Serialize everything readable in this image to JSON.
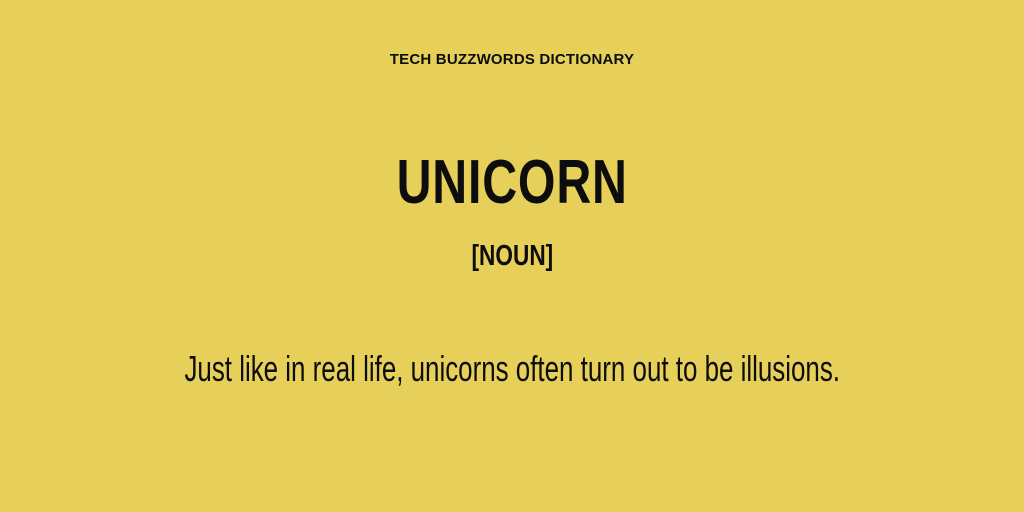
{
  "header": {
    "label": "TECH BUZZWORDS DICTIONARY"
  },
  "entry": {
    "term": "UNICORN",
    "part_of_speech": "[NOUN]",
    "definition": "Just like in real life, unicorns often turn out to be illusions."
  },
  "colors": {
    "background": "#e6d05a",
    "text": "#0d0d0d"
  }
}
